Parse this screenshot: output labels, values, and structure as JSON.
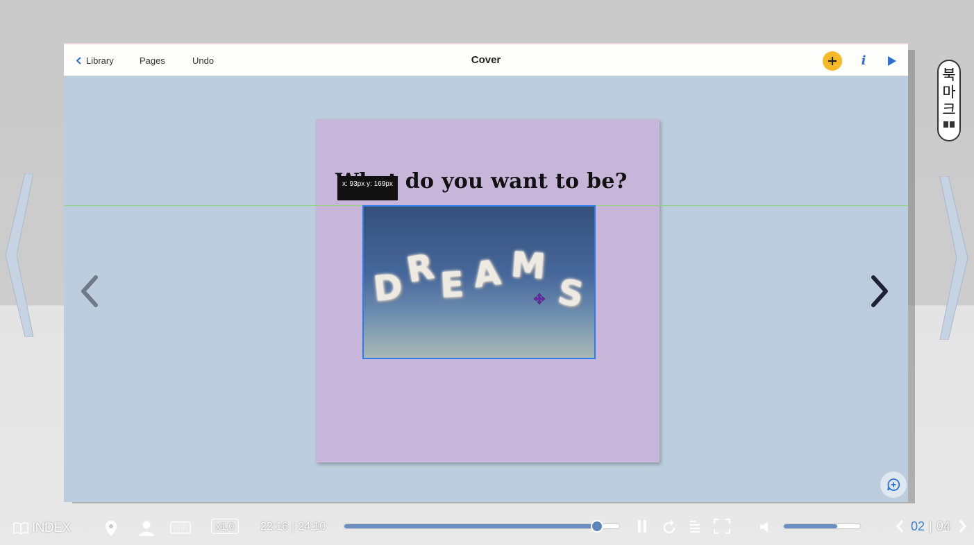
{
  "toolbar": {
    "back_label": "Library",
    "pages_label": "Pages",
    "undo_label": "Undo",
    "title": "Cover",
    "add_icon": "plus-icon",
    "info_label": "i",
    "play_icon": "play-icon"
  },
  "page": {
    "heading": "What do you want to be?",
    "cursor_tooltip": "x: 93px y: 169px",
    "image_alt": "DREAMS",
    "image_letters": [
      "D",
      "R",
      "E",
      "A",
      "M",
      "S"
    ]
  },
  "bookmark": {
    "chars": [
      "북",
      "마",
      "크"
    ],
    "icon": "book-icon"
  },
  "bottom_bar": {
    "index_label": "INDEX",
    "speed_label": "x1.0",
    "time_current": "22:16",
    "time_separator": "|",
    "time_total": "24:10",
    "progress": 0.92,
    "volume": 0.7,
    "page_current": "02",
    "page_separator": "|",
    "page_total": "04",
    "icons": [
      "book-icon",
      "location-pin-icon",
      "person-icon",
      "keyboard-icon",
      "pause-icon",
      "replay-icon",
      "list-icon",
      "fullscreen-icon",
      "speaker-icon",
      "chevron-left-icon",
      "chevron-right-icon"
    ]
  },
  "colors": {
    "canvas_bg": "#bccedd",
    "page_bg": "#c7b6da",
    "accent_yellow": "#f6b928",
    "accent_blue": "#2b6fd6",
    "guide_green": "#8fd37a"
  }
}
